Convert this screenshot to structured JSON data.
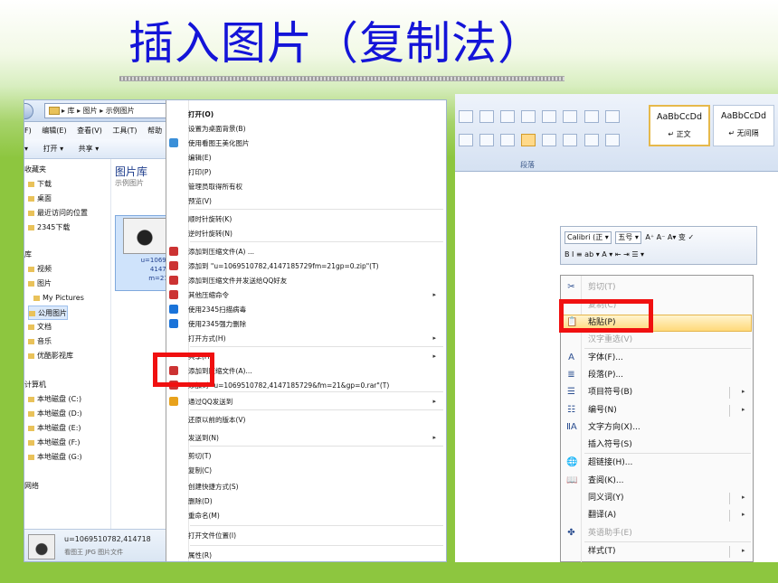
{
  "title": "插入图片（复制法）",
  "explorer": {
    "breadcrumb": "▸ 库 ▸ 图片 ▸ 示例图片",
    "menu": [
      "F)",
      "编辑(E)",
      "查看(V)",
      "工具(T)",
      "帮助"
    ],
    "toolbar": [
      "▾",
      "打开 ▾",
      "共享 ▾"
    ],
    "nav": [
      "收藏夹",
      "下载",
      "桌面",
      "最近访问的位置",
      "2345下载",
      "库",
      "视频",
      "图片",
      "My Pictures",
      "公用图片",
      "文档",
      "音乐",
      "优酷影视库",
      "计算机",
      "本地磁盘 (C:)",
      "本地磁盘 (D:)",
      "本地磁盘 (E:)",
      "本地磁盘 (F:)",
      "本地磁盘 (G:)",
      "网络"
    ],
    "nav_selected_index": 9,
    "library_title": "图片库",
    "library_subtitle": "示例图片",
    "thumb_caption": "u=106951078\n414718572\nm=21&gp=",
    "status_name": "u=1069510782,414718",
    "status_type": "看图王 JPG 图片文件"
  },
  "explorer_menu": {
    "items": [
      {
        "label": "打开(O)",
        "bold": true
      },
      {
        "label": "设置为桌面背景(B)"
      },
      {
        "label": "使用看图王美化图片"
      },
      {
        "label": "编辑(E)"
      },
      {
        "label": "打印(P)"
      },
      {
        "label": "管理员取得所有权"
      },
      {
        "label": "预览(V)"
      },
      {
        "label": "顺时针旋转(K)"
      },
      {
        "label": "逆时针旋转(N)"
      },
      {
        "label": "添加到压缩文件(A) ..."
      },
      {
        "label": "添加到 \"u=1069510782,4147185729fm=21gp=0.zip\"(T)"
      },
      {
        "label": "添加到压缩文件并发送给QQ好友"
      },
      {
        "label": "其他压缩命令",
        "arrow": true
      },
      {
        "label": "使用2345扫描病毒"
      },
      {
        "label": "使用2345强力删除"
      },
      {
        "label": "打开方式(H)",
        "arrow": true
      },
      {
        "label": "共享(H)",
        "arrow": true
      },
      {
        "label": "添加到压缩文件(A)..."
      },
      {
        "label": "添加到 \"u=1069510782,4147185729&fm=21&gp=0.rar\"(T)"
      },
      {
        "label": "通过QQ发送到",
        "arrow": true
      },
      {
        "label": "还原以前的版本(V)"
      },
      {
        "label": "发送到(N)",
        "arrow": true
      },
      {
        "label": "剪切(T)"
      },
      {
        "label": "复制(C)"
      },
      {
        "label": "创建快捷方式(S)"
      },
      {
        "label": "删除(D)"
      },
      {
        "label": "重命名(M)"
      },
      {
        "label": "打开文件位置(I)"
      },
      {
        "label": "属性(R)"
      }
    ]
  },
  "word": {
    "style1_sample": "AaBbCcDd",
    "style1_name": "↵ 正文",
    "style2_sample": "AaBbCcDd",
    "style2_name": "↵ 无间隔",
    "group_label": "段落",
    "mini_font": "Calibri (正 ▾",
    "mini_size": "五号 ▾",
    "mini_row2": "B  I  ≡  ab ▾  A ▾  ⇤  ⇥  ☰ ▾",
    "mini_grow": "A⁺ A⁻ A▾ 变 ✓"
  },
  "word_menu": {
    "items": [
      {
        "label": "剪切(T)",
        "disabled": true,
        "icon": "✂"
      },
      {
        "label": "复制(C)",
        "disabled": true,
        "icon": ""
      },
      {
        "label": "粘贴(P)",
        "icon": "📋",
        "highlight": true
      },
      {
        "label": "汉字重选(V)",
        "disabled": true,
        "icon": ""
      },
      {
        "label": "字体(F)...",
        "icon": "A"
      },
      {
        "label": "段落(P)...",
        "icon": "≣"
      },
      {
        "label": "项目符号(B)",
        "icon": "☰",
        "arrow": true
      },
      {
        "label": "编号(N)",
        "icon": "☷",
        "arrow": true
      },
      {
        "label": "文字方向(X)...",
        "icon": "ⅡA"
      },
      {
        "label": "插入符号(S)",
        "icon": ""
      },
      {
        "label": "超链接(H)...",
        "icon": "🌐"
      },
      {
        "label": "查阅(K)...",
        "icon": "📖"
      },
      {
        "label": "同义词(Y)",
        "icon": "",
        "arrow": true
      },
      {
        "label": "翻译(A)",
        "icon": "",
        "arrow": true
      },
      {
        "label": "英语助手(E)",
        "disabled": true,
        "icon": "✤"
      },
      {
        "label": "样式(T)",
        "icon": "",
        "arrow": true
      }
    ]
  },
  "accent": {
    "title_color": "#1414d8",
    "highlight_box": "#f01010",
    "background": "#8dc63f"
  },
  "icons": [
    "folder-icon",
    "back-arrow-icon",
    "scissors-icon",
    "paste-icon",
    "font-icon",
    "paragraph-icon",
    "bullets-icon",
    "numbering-icon",
    "hyperlink-icon",
    "lookup-icon"
  ]
}
